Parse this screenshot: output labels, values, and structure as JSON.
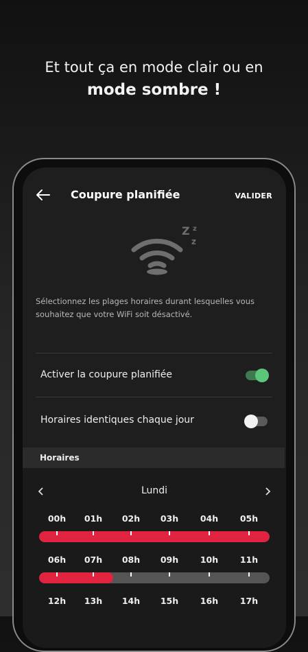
{
  "promo": {
    "line1": "Et tout ça en mode clair ou en",
    "line2": "mode sombre !"
  },
  "appbar": {
    "title": "Coupure planifiée",
    "validate_label": "VALIDER",
    "back_icon": "arrow-left-icon"
  },
  "illustration": {
    "icon": "wifi-sleep-icon",
    "zzz": "Z z z"
  },
  "description": "Sélectionnez les plages horaires durant lesquelles vous souhaitez que votre WiFi soit désactivé.",
  "settings": [
    {
      "label": "Activer la coupure planifiée",
      "enabled": true
    },
    {
      "label": "Horaires identiques chaque jour",
      "enabled": false
    }
  ],
  "schedule": {
    "section_title": "Horaires",
    "day": "Lundi",
    "rows": [
      {
        "hours": [
          "00h",
          "01h",
          "02h",
          "03h",
          "04h",
          "05h"
        ],
        "fill_fraction": 1.0
      },
      {
        "hours": [
          "06h",
          "07h",
          "08h",
          "09h",
          "10h",
          "11h"
        ],
        "fill_fraction": 0.32
      },
      {
        "hours": [
          "12h",
          "13h",
          "14h",
          "15h",
          "16h",
          "17h"
        ],
        "fill_fraction": 0
      }
    ]
  },
  "colors": {
    "accent": "#e0233e",
    "toggle_on": "#5cc77a",
    "background": "#1e1e1e"
  }
}
